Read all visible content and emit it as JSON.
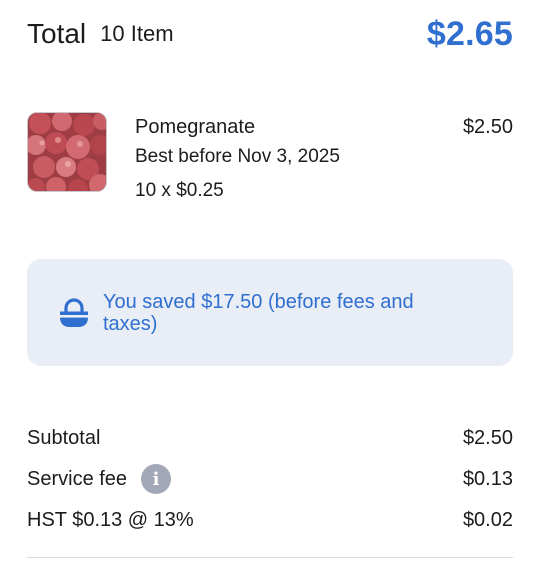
{
  "header": {
    "total_label": "Total",
    "item_count": "10 Item",
    "total_amount": "$2.65"
  },
  "item": {
    "image": "pomegranate-photo",
    "name": "Pomegranate",
    "best_before": "Best before Nov 3, 2025",
    "quantity": "10 x $0.25",
    "price": "$2.50"
  },
  "savings": {
    "icon": "basket-icon",
    "text": "You saved $17.50  (before fees and taxes)"
  },
  "summary": {
    "subtotal_label": "Subtotal",
    "subtotal_value": "$2.50",
    "service_fee_label": "Service fee",
    "service_fee_info_glyph": "i",
    "service_fee_value": "$0.13",
    "hst_label": "HST $0.13 @ 13%",
    "hst_value": "$0.02"
  },
  "colors": {
    "accent": "#2f6fd0",
    "savings_bg": "#e9edf6",
    "info_icon_bg": "#a3a8b8"
  }
}
